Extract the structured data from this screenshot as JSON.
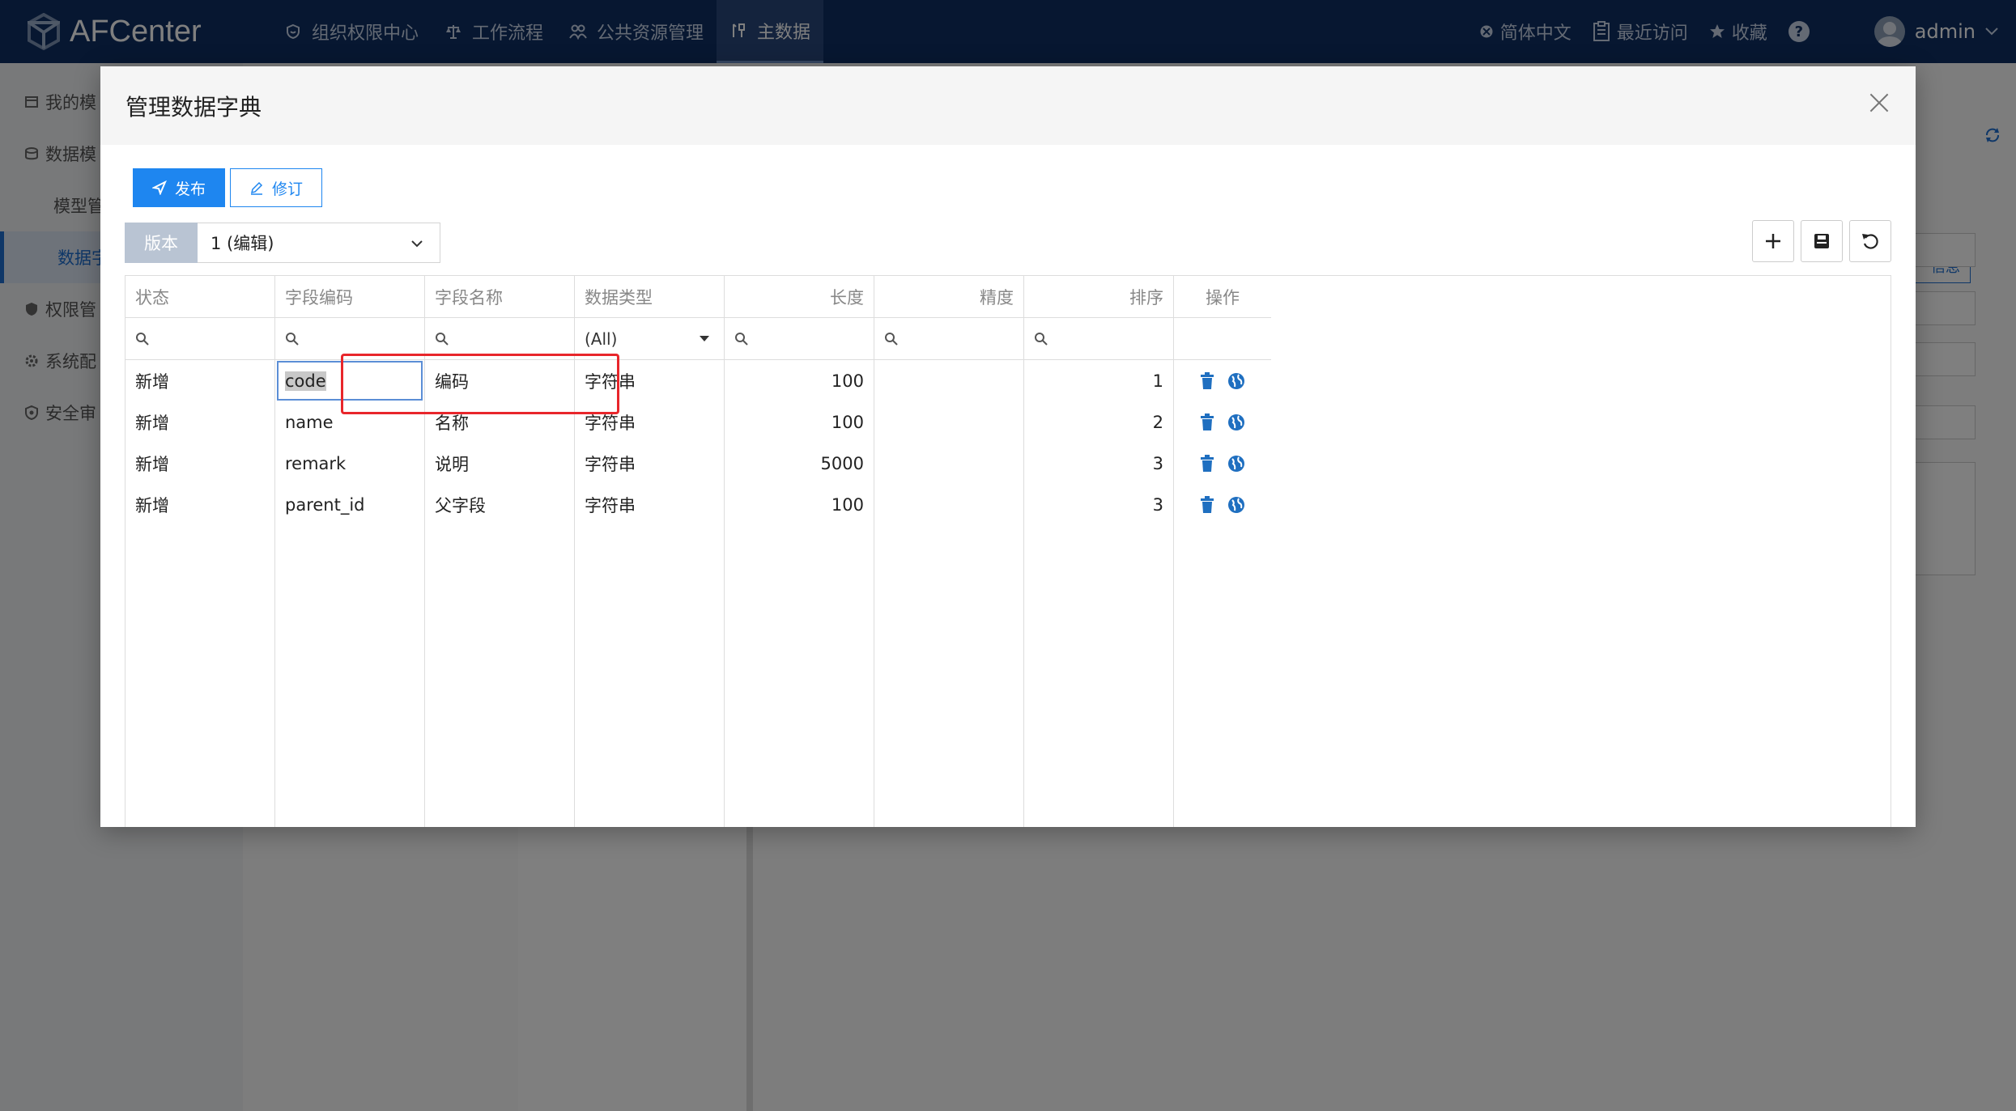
{
  "app": {
    "name": "AFCenter"
  },
  "nav": [
    {
      "label": "组织权限中心",
      "icon": "smile-shield-icon"
    },
    {
      "label": "工作流程",
      "icon": "scale-icon"
    },
    {
      "label": "公共资源管理",
      "icon": "people-icon"
    },
    {
      "label": "主数据",
      "icon": "tools-icon",
      "active": true
    }
  ],
  "tools": {
    "language": "简体中文",
    "recent": "最近访问",
    "favorites": "收藏",
    "help": "?",
    "user": "admin"
  },
  "sidebar": {
    "items": [
      {
        "label": "我的模",
        "icon": "box-icon"
      },
      {
        "label": "数据模",
        "icon": "database-icon"
      },
      {
        "label": "模型管",
        "sub": true
      },
      {
        "label": "数据字",
        "sub": true,
        "active": true
      },
      {
        "label": "权限管",
        "icon": "shield-icon"
      },
      {
        "label": "系统配",
        "icon": "gear-icon"
      },
      {
        "label": "安全审",
        "icon": "security-icon"
      }
    ]
  },
  "background": {
    "info_button": "信息"
  },
  "modal": {
    "title": "管理数据字典",
    "publish_label": "发布",
    "revise_label": "修订",
    "version_label": "版本",
    "version_value": "1 (编辑)"
  },
  "grid": {
    "columns": [
      {
        "key": "status",
        "label": "状态",
        "align": "left"
      },
      {
        "key": "code",
        "label": "字段编码",
        "align": "left"
      },
      {
        "key": "name",
        "label": "字段名称",
        "align": "left"
      },
      {
        "key": "type",
        "label": "数据类型",
        "align": "left"
      },
      {
        "key": "length",
        "label": "长度",
        "align": "right"
      },
      {
        "key": "precision",
        "label": "精度",
        "align": "right"
      },
      {
        "key": "order",
        "label": "排序",
        "align": "right"
      },
      {
        "key": "actions",
        "label": "操作",
        "align": "center"
      }
    ],
    "type_filter": "(All)",
    "rows": [
      {
        "status": "新增",
        "code": "code",
        "name": "编码",
        "type": "字符串",
        "length": "100",
        "precision": "",
        "order": "1"
      },
      {
        "status": "新增",
        "code": "name",
        "name": "名称",
        "type": "字符串",
        "length": "100",
        "precision": "",
        "order": "2"
      },
      {
        "status": "新增",
        "code": "remark",
        "name": "说明",
        "type": "字符串",
        "length": "5000",
        "precision": "",
        "order": "3"
      },
      {
        "status": "新增",
        "code": "parent_id",
        "name": "父字段",
        "type": "字符串",
        "length": "100",
        "precision": "",
        "order": "3"
      }
    ]
  },
  "colors": {
    "topbar": "#0f2f63",
    "primary": "#1e86f0",
    "highlight": "#e8262b",
    "action_icon": "#1f6fc0"
  }
}
